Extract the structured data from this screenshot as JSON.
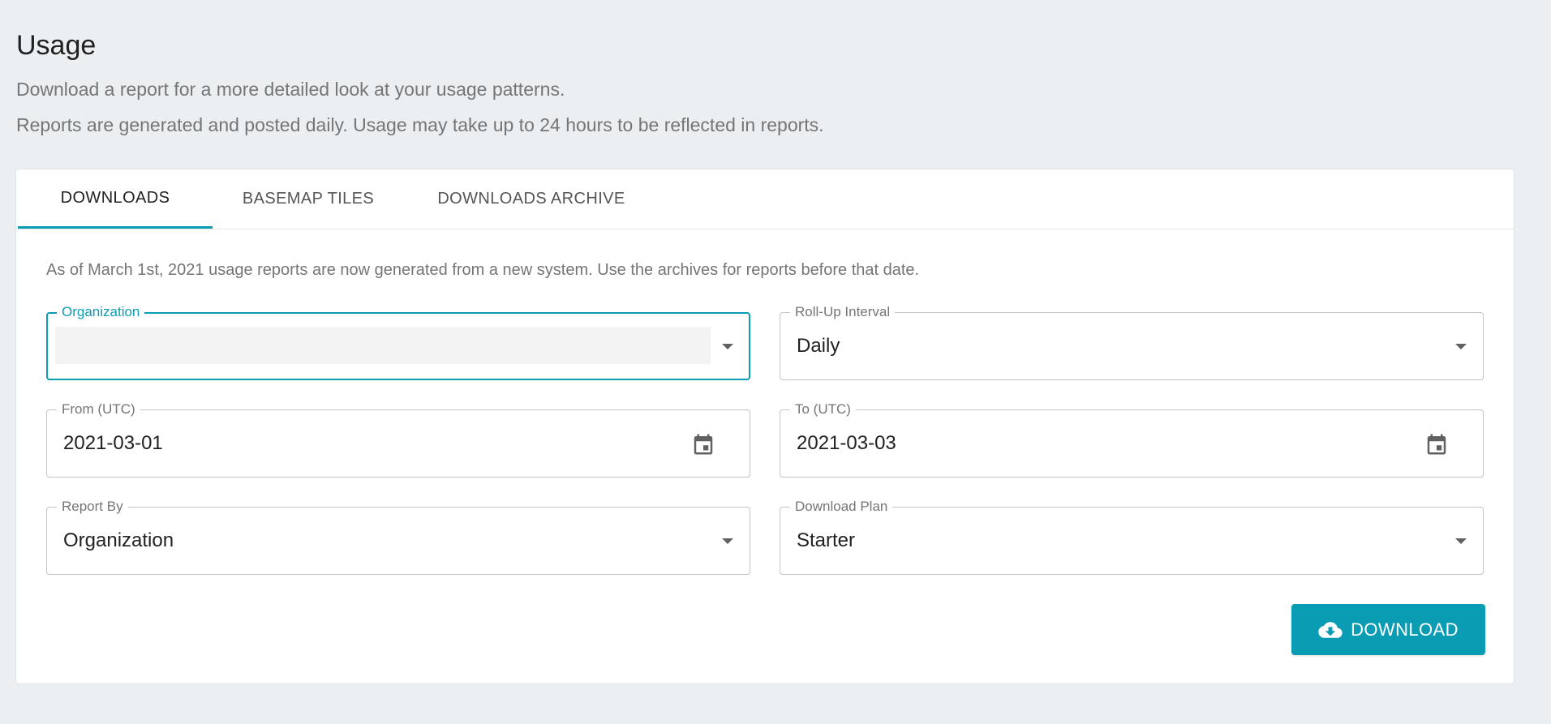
{
  "header": {
    "title": "Usage",
    "subtitle_1": "Download a report for a more detailed look at your usage patterns.",
    "subtitle_2": "Reports are generated and posted daily. Usage may take up to 24 hours to be reflected in reports."
  },
  "tabs": [
    {
      "label": "DOWNLOADS",
      "active": true
    },
    {
      "label": "BASEMAP TILES",
      "active": false
    },
    {
      "label": "DOWNLOADS ARCHIVE",
      "active": false
    }
  ],
  "notice": "As of March 1st, 2021 usage reports are now generated from a new system. Use the archives for reports before that date.",
  "form": {
    "organization": {
      "label": "Organization",
      "value": ""
    },
    "rollup_interval": {
      "label": "Roll-Up Interval",
      "value": "Daily"
    },
    "from": {
      "label": "From (UTC)",
      "value": "2021-03-01"
    },
    "to": {
      "label": "To (UTC)",
      "value": "2021-03-03"
    },
    "report_by": {
      "label": "Report By",
      "value": "Organization"
    },
    "download_plan": {
      "label": "Download Plan",
      "value": "Starter"
    }
  },
  "actions": {
    "download_label": "DOWNLOAD",
    "download_icon": "cloud-download-icon"
  },
  "colors": {
    "accent": "#0a9cb2",
    "background": "#eceff1"
  }
}
